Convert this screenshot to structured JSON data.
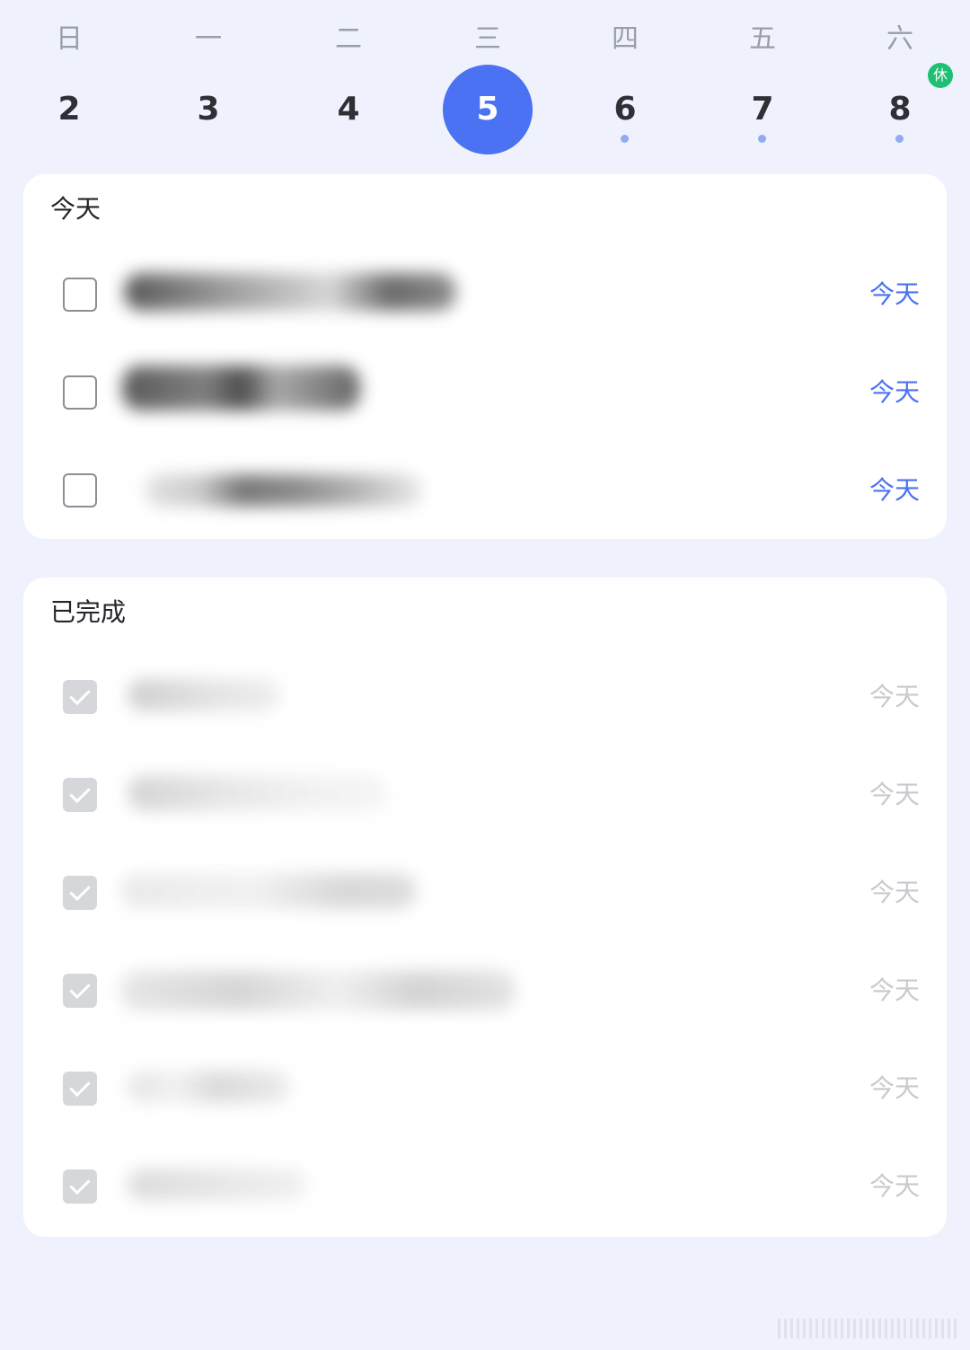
{
  "week": {
    "days": [
      {
        "weekday": "日",
        "date": "2",
        "selected": false,
        "has_dot": false,
        "badge": ""
      },
      {
        "weekday": "一",
        "date": "3",
        "selected": false,
        "has_dot": false,
        "badge": ""
      },
      {
        "weekday": "二",
        "date": "4",
        "selected": false,
        "has_dot": false,
        "badge": ""
      },
      {
        "weekday": "三",
        "date": "5",
        "selected": true,
        "has_dot": false,
        "badge": ""
      },
      {
        "weekday": "四",
        "date": "6",
        "selected": false,
        "has_dot": true,
        "badge": ""
      },
      {
        "weekday": "五",
        "date": "7",
        "selected": false,
        "has_dot": true,
        "badge": ""
      },
      {
        "weekday": "六",
        "date": "8",
        "selected": false,
        "has_dot": true,
        "badge": "休"
      }
    ]
  },
  "today_section": {
    "title": "今天",
    "tasks": [
      {
        "due": "今天",
        "checked": false
      },
      {
        "due": "今天",
        "checked": false
      },
      {
        "due": "今天",
        "checked": false
      }
    ]
  },
  "completed_section": {
    "title": "已完成",
    "tasks": [
      {
        "due": "今天",
        "checked": true
      },
      {
        "due": "今天",
        "checked": true
      },
      {
        "due": "今天",
        "checked": true
      },
      {
        "due": "今天",
        "checked": true
      },
      {
        "due": "今天",
        "checked": true
      },
      {
        "due": "今天",
        "checked": true
      }
    ]
  },
  "colors": {
    "accent": "#4A72F2",
    "background": "#EFF2FC",
    "holiday_badge": "#1DBF73",
    "completed_text": "#C9CACE"
  }
}
